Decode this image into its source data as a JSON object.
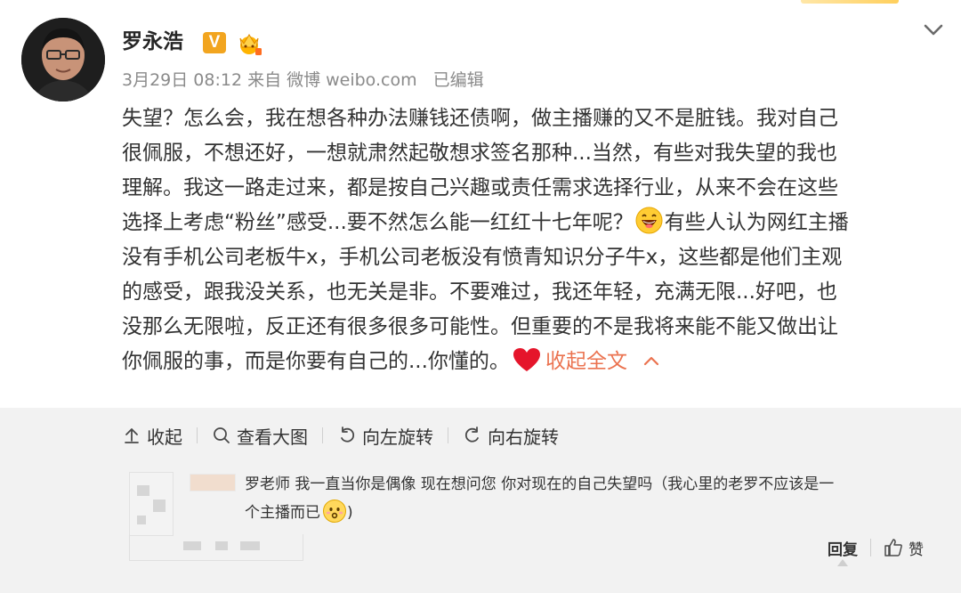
{
  "post": {
    "username": "罗永浩",
    "vip_badge": "V",
    "meta": {
      "date": "3月29日 08:12",
      "source_prefix": "来自",
      "source": "微博 weibo.com",
      "edited": "已编辑"
    },
    "content_lines": [
      "失望？怎么会，我在想各种办法赚钱还债啊，做主播赚的又不是脏钱。我对自己",
      "很佩服，不想还好，一想就肃然起敬想求签名那种...当然，有些对我失望的我也",
      "理解。我这一路走过来，都是按自己兴趣或责任需求选择行业，从来不会在这些",
      "选择上考虑“粉丝”感受...要不然怎么能一红红十七年呢？",
      "有些人认为网红主播",
      "没有手机公司老板牛x，手机公司老板没有愤青知识分子牛x，这些都是他们主观",
      "的感受，跟我没关系，也无关是非。不要难过，我还年轻，充满无限...好吧，也",
      "没那么无限啦，反正还有很多很多可能性。但重要的不是我将来能不能又做出让",
      "你佩服的事，而是你要有自己的...你懂的。"
    ],
    "collapse_label": "收起全文"
  },
  "toolbar": {
    "collapse": "收起",
    "view_large": "查看大图",
    "rotate_left": "向左旋转",
    "rotate_right": "向右旋转"
  },
  "comment": {
    "lines": [
      "罗老师 我一直当你是偶像 现在想问您 你对现在的自己失望吗（我心里的老罗不应该是一",
      "个主播而已"
    ],
    "tail": ")",
    "reply_label": "回复",
    "like_label": "赞"
  },
  "colors": {
    "accent": "#eb7350",
    "vip_badge": "#f2a51f",
    "action_bg": "#f2f2f2",
    "meta_text": "#8a8a8a"
  },
  "icons": [
    "chevron-down-icon",
    "crown-icon",
    "laugh-emoji-icon",
    "heart-icon",
    "chevron-up-icon",
    "arrow-up-icon",
    "search-icon",
    "rotate-left-icon",
    "rotate-right-icon",
    "thumb-up-icon",
    "sad-emoji-icon"
  ]
}
